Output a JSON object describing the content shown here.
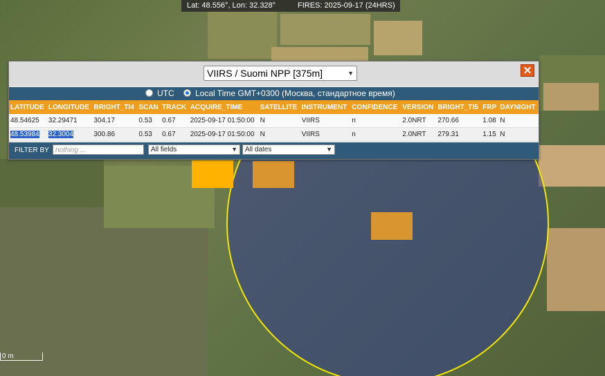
{
  "status_bar": {
    "coords": "Lat: 48.556°, Lon: 32.328°",
    "fires": "FIRES: 2025-09-17 (24HRS)"
  },
  "panel": {
    "satellite_select": "VIIRS / Suomi NPP [375m]",
    "close_label": "✕",
    "timezone": {
      "utc_label": "UTC",
      "local_label": "Local Time GMT+0300 (Москва, стандартное время)",
      "selected": "local"
    },
    "table": {
      "headers": [
        "LATITUDE",
        "LONGITUDE",
        "BRIGHT_TI4",
        "SCAN",
        "TRACK",
        "ACQUIRE_TIME",
        "SATELLITE",
        "INSTRUMENT",
        "CONFIDENCE",
        "VERSION",
        "BRIGHT_TI5",
        "FRP",
        "DAYNIGHT"
      ],
      "rows": [
        [
          "48.54625",
          "32.29471",
          "304.17",
          "0.53",
          "0.67",
          "2025-09-17 01:50:00",
          "N",
          "VIIRS",
          "n",
          "2.0NRT",
          "270.66",
          "1.08",
          "N"
        ],
        [
          "48.53984",
          "32.3004",
          "300.86",
          "0.53",
          "0.67",
          "2025-09-17 01:50:00",
          "N",
          "VIIRS",
          "n",
          "2.0NRT",
          "279.31",
          "1.15",
          "N"
        ]
      ]
    },
    "filter": {
      "label": "FILTER BY",
      "placeholder": "nothing ...",
      "field_select": "All fields",
      "date_select": "All dates"
    }
  },
  "map": {
    "scale_label": "0 m",
    "colors": {
      "fire_hot": "#ffb300",
      "fire_warm": "#d99530",
      "radius_circle": "#f2e800"
    }
  }
}
